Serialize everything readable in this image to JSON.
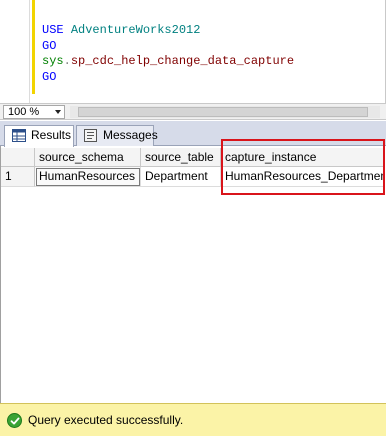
{
  "editor": {
    "lines": [
      {
        "keyword": "USE",
        "object": "AdventureWorks2012"
      },
      {
        "keyword": "GO"
      },
      {
        "schema": "sys",
        "procedure": "sp_cdc_help_change_data_capture"
      },
      {
        "keyword": "GO"
      }
    ],
    "colors": {
      "keyword": "#0000ff",
      "object": "#008080",
      "procedure": "#800000",
      "schema": "#008000",
      "change_bar": "#f2d400"
    }
  },
  "zoom": {
    "value": "100 %"
  },
  "tabs": [
    {
      "label": "Results",
      "icon": "grid-icon",
      "active": true
    },
    {
      "label": "Messages",
      "icon": "messages-icon",
      "active": false
    }
  ],
  "grid": {
    "columns": [
      "source_schema",
      "source_table",
      "capture_instance"
    ],
    "rows": [
      {
        "row_number": "1",
        "cells": [
          "HumanResources",
          "Department",
          "HumanResources_Department"
        ]
      }
    ],
    "highlight_color": "#d9141b"
  },
  "status": {
    "text": "Query executed successfully.",
    "icon": "success-check-icon",
    "background": "#fbf3a7"
  }
}
